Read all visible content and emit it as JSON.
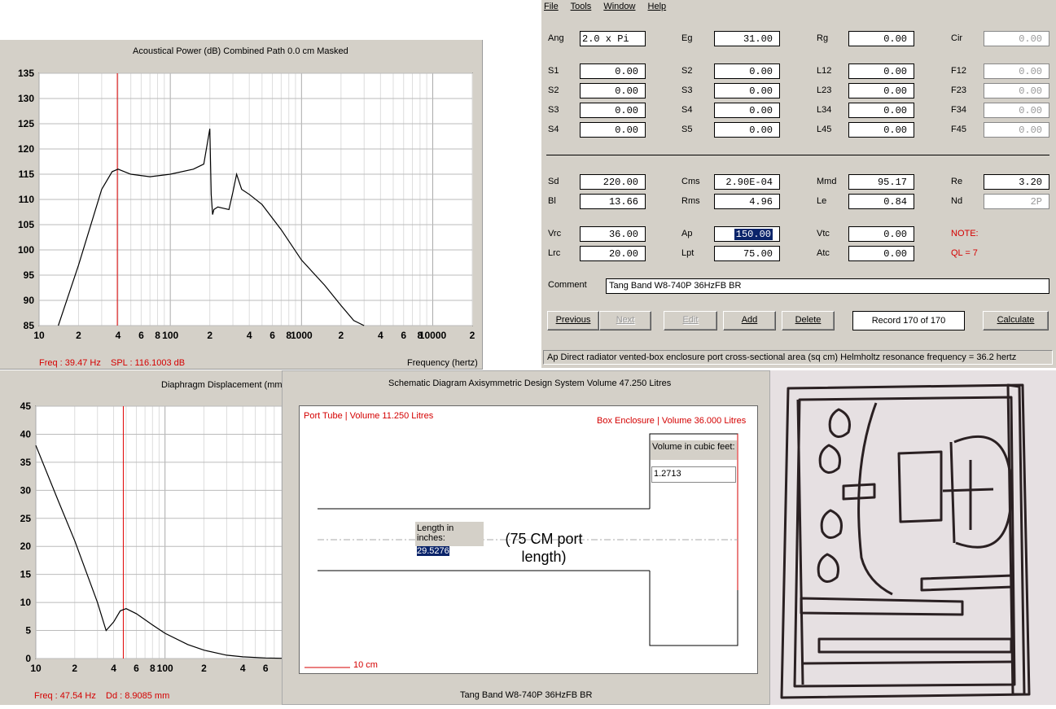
{
  "spl_window": {
    "title": "Acoustical Power (dB)   Combined   Path 0.0 cm   Masked",
    "y_ticks": [
      "135",
      "130",
      "125",
      "120",
      "115",
      "110",
      "105",
      "100",
      "95",
      "90",
      "85"
    ],
    "x_ticks": [
      "10",
      "2",
      "4",
      "6",
      "8",
      "100",
      "2",
      "4",
      "6",
      "8",
      "1000",
      "2",
      "4",
      "6",
      "8",
      "10000",
      "2"
    ],
    "status_freq": "Freq : 39.47 Hz",
    "status_spl": "SPL : 116.1003 dB",
    "x_caption": "Frequency (hertz)"
  },
  "params_window": {
    "menu": [
      "File",
      "Tools",
      "Window",
      "Help"
    ],
    "rows": [
      [
        {
          "l": "Ang",
          "v": "2.0 x Pi",
          "left": true
        },
        {
          "l": "Eg",
          "v": "31.00"
        },
        {
          "l": "Rg",
          "v": "0.00"
        },
        {
          "l": "Cir",
          "v": "0.00",
          "dis": true
        }
      ],
      [
        {
          "l": "S1",
          "v": "0.00"
        },
        {
          "l": "S2",
          "v": "0.00"
        },
        {
          "l": "L12",
          "v": "0.00"
        },
        {
          "l": "F12",
          "v": "0.00",
          "dis": true
        }
      ],
      [
        {
          "l": "S2",
          "v": "0.00"
        },
        {
          "l": "S3",
          "v": "0.00"
        },
        {
          "l": "L23",
          "v": "0.00"
        },
        {
          "l": "F23",
          "v": "0.00",
          "dis": true
        }
      ],
      [
        {
          "l": "S3",
          "v": "0.00"
        },
        {
          "l": "S4",
          "v": "0.00"
        },
        {
          "l": "L34",
          "v": "0.00"
        },
        {
          "l": "F34",
          "v": "0.00",
          "dis": true
        }
      ],
      [
        {
          "l": "S4",
          "v": "0.00"
        },
        {
          "l": "S5",
          "v": "0.00"
        },
        {
          "l": "L45",
          "v": "0.00"
        },
        {
          "l": "F45",
          "v": "0.00",
          "dis": true
        }
      ],
      [
        {
          "l": "Sd",
          "v": "220.00"
        },
        {
          "l": "Cms",
          "v": "2.90E-04"
        },
        {
          "l": "Mmd",
          "v": "95.17"
        },
        {
          "l": "Re",
          "v": "3.20"
        }
      ],
      [
        {
          "l": "Bl",
          "v": "13.66"
        },
        {
          "l": "Rms",
          "v": "4.96"
        },
        {
          "l": "Le",
          "v": "0.84"
        },
        {
          "l": "Nd",
          "v": "2P",
          "dis": true
        }
      ],
      [
        {
          "l": "Vrc",
          "v": "36.00"
        },
        {
          "l": "Ap",
          "v": "150.00",
          "sel": true
        },
        {
          "l": "Vtc",
          "v": "0.00"
        },
        {
          "l": "NOTE:",
          "red": true
        }
      ],
      [
        {
          "l": "Lrc",
          "v": "20.00"
        },
        {
          "l": "Lpt",
          "v": "75.00"
        },
        {
          "l": "Atc",
          "v": "0.00"
        },
        {
          "l": "QL = 7",
          "red": true
        }
      ]
    ],
    "comment_label": "Comment",
    "comment_value": "Tang Band W8-740P  36HzFB BR",
    "buttons": {
      "previous": "Previous",
      "next": "Next",
      "edit": "Edit",
      "add": "Add",
      "delete": "Delete",
      "calculate": "Calculate"
    },
    "record": "Record 170 of 170",
    "status_text": "Ap   Direct radiator vented-box enclosure port cross-sectional area  (sq cm)   Helmholtz resonance frequency = 36.2 hertz"
  },
  "disp_window": {
    "title": "Diaphragm Displacement (mm)",
    "y_ticks": [
      "45",
      "40",
      "35",
      "30",
      "25",
      "20",
      "15",
      "10",
      "5",
      "0"
    ],
    "x_ticks": [
      "10",
      "2",
      "4",
      "6",
      "8",
      "100",
      "2",
      "4",
      "6"
    ],
    "status_freq": "Freq : 47.54 Hz",
    "status_dd": "Dd : 8.9085 mm"
  },
  "schematic_window": {
    "title": "Schematic Diagram   Axisymmetric Design   System Volume 47.250 Litres",
    "port_label": "Port Tube | Volume 11.250 Litres",
    "box_label": "Box Enclosure | Volume 36.000 Litres",
    "volume_label": "Volume in cubic feet:",
    "volume_value": "1.2713",
    "length_label": "Length in inches:",
    "length_value": "29.5276",
    "annotation_1": "(75 CM port",
    "annotation_2": "length)",
    "scale_label": "10 cm",
    "footer": "Tang Band W8-740P  36HzFB BR"
  },
  "chart_data": [
    {
      "type": "line",
      "title": "Acoustical Power (dB)   Combined   Path 0.0 cm   Masked",
      "xlabel": "Frequency (hertz)",
      "ylabel": "",
      "xscale": "log",
      "xlim": [
        10,
        20000
      ],
      "ylim": [
        85,
        135
      ],
      "cursor_x": 39.47,
      "series": [
        {
          "x": [
            14,
            20,
            30,
            36,
            40,
            50,
            70,
            100,
            150,
            180,
            200,
            205,
            210,
            215,
            230,
            280,
            300,
            320,
            350,
            400,
            500,
            700,
            1000,
            1500,
            2000,
            2500,
            3000
          ],
          "y": [
            85,
            97,
            112,
            115.5,
            116,
            115,
            114.5,
            115,
            116,
            117,
            124,
            111,
            107,
            108,
            108.5,
            108,
            111.5,
            115,
            112,
            111,
            109,
            104,
            98,
            93,
            89,
            86,
            85
          ]
        }
      ]
    },
    {
      "type": "line",
      "title": "Diaphragm Displacement (mm)",
      "xlabel": "",
      "ylabel": "",
      "xscale": "log",
      "xlim": [
        10,
        800
      ],
      "ylim": [
        0,
        45
      ],
      "cursor_x": 47.54,
      "series": [
        {
          "x": [
            10,
            15,
            20,
            30,
            35,
            40,
            45,
            50,
            60,
            80,
            100,
            150,
            200,
            300,
            400,
            600,
            800
          ],
          "y": [
            38,
            28,
            21,
            10,
            5,
            6.5,
            8.5,
            8.9,
            8,
            6,
            4.5,
            2.5,
            1.5,
            0.6,
            0.3,
            0.1,
            0.05
          ]
        }
      ]
    }
  ]
}
